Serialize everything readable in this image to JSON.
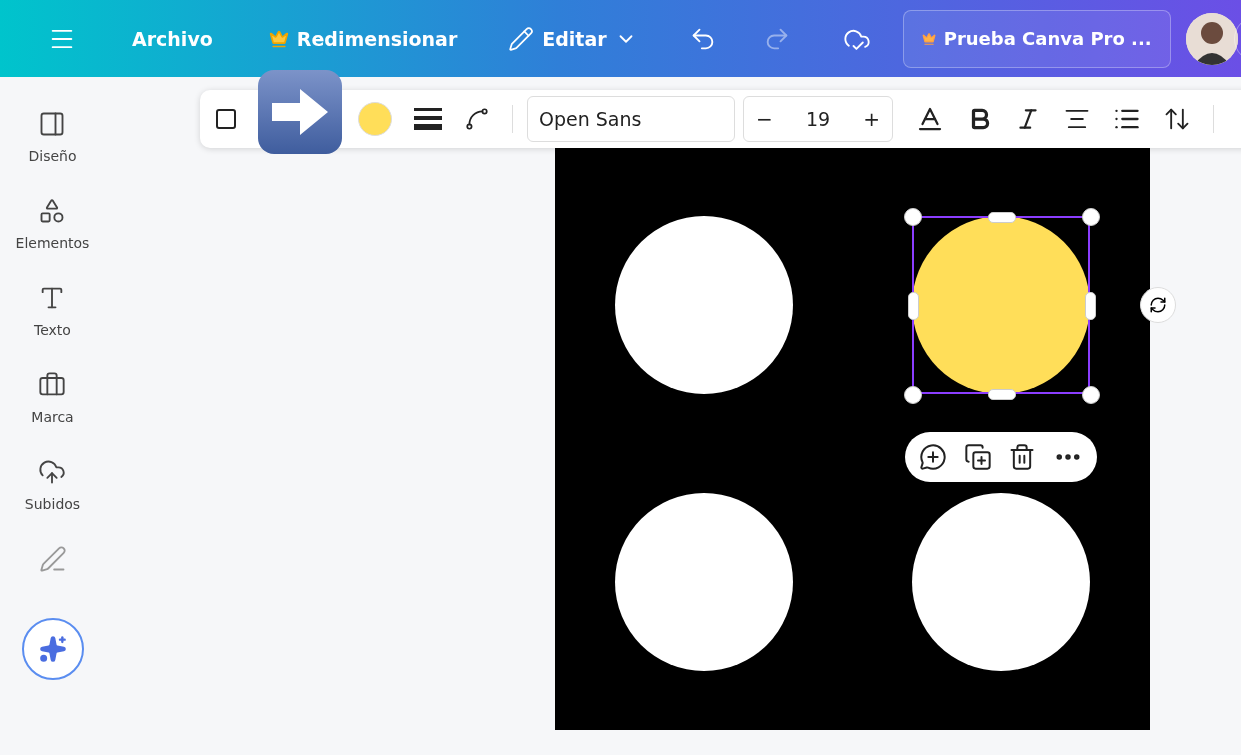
{
  "top_bar": {
    "file": "Archivo",
    "resize": "Redimensionar",
    "edit": "Editar",
    "undo": {
      "disabled": false
    },
    "redo": {
      "disabled": true
    },
    "pro_button": "Prueba Canva Pro ..."
  },
  "toolbar": {
    "fill": {
      "color": "#ffde59"
    },
    "font": "Open Sans",
    "font_size": "19",
    "decrease": "−",
    "increase": "+"
  },
  "sidebar": {
    "items": [
      {
        "kind": "design",
        "label": "Diseño"
      },
      {
        "kind": "elements",
        "label": "Elementos"
      },
      {
        "kind": "text",
        "label": "Texto"
      },
      {
        "kind": "brand",
        "label": "Marca"
      },
      {
        "kind": "uploads",
        "label": "Subidos"
      },
      {
        "kind": "draw"
      }
    ]
  },
  "canvas": {
    "shapes": [
      {
        "color": "#ffffff",
        "selected": false
      },
      {
        "color": "#ffde59",
        "selected": true
      },
      {
        "color": "#ffffff",
        "selected": false
      },
      {
        "color": "#ffffff",
        "selected": false
      }
    ]
  }
}
